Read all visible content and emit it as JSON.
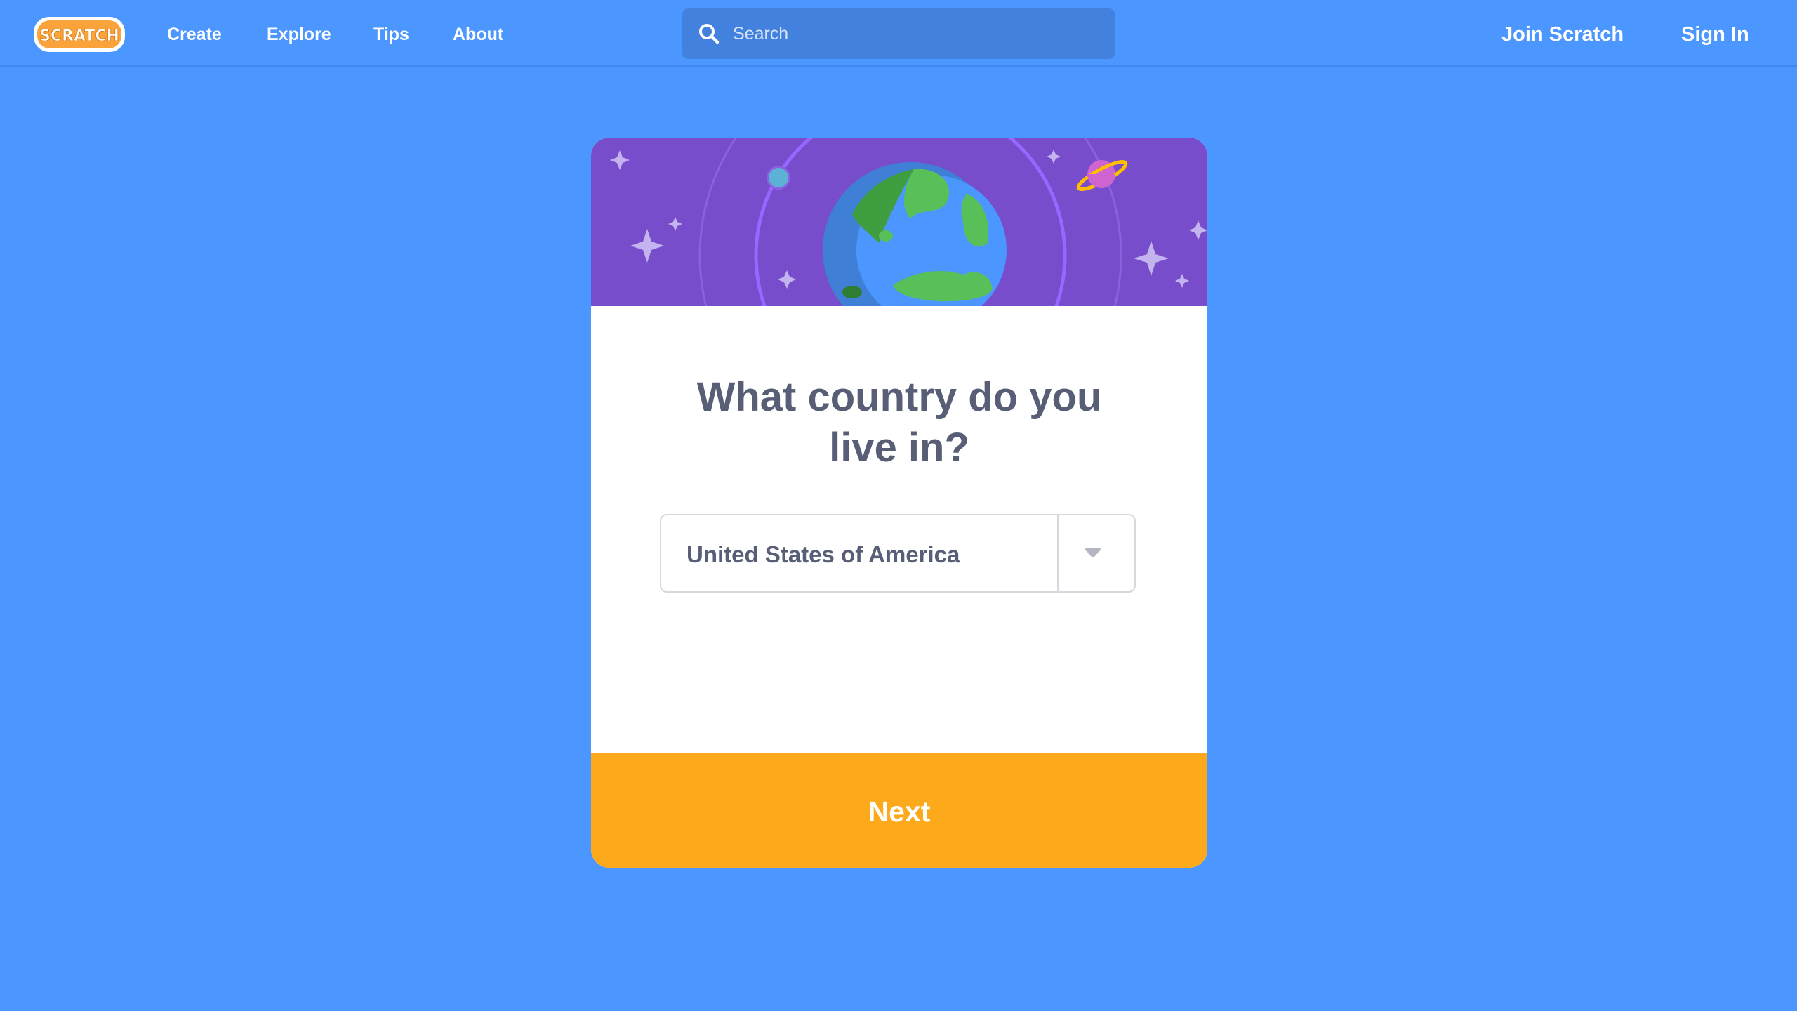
{
  "header": {
    "logo_text": "SCRATCH",
    "nav": {
      "create": "Create",
      "explore": "Explore",
      "tips": "Tips",
      "about": "About"
    },
    "search": {
      "placeholder": "Search",
      "icon": "search-icon"
    },
    "join_label": "Join Scratch",
    "signin_label": "Sign In"
  },
  "card": {
    "banner_icon": "globe-illustration",
    "title_line1": "What country do you",
    "title_line2": "live in?",
    "select": {
      "value": "United States of America",
      "icon": "chevron-down-icon"
    },
    "next_label": "Next"
  },
  "colors": {
    "background": "#4c97ff",
    "search_bg": "#4281de",
    "banner_purple": "#774dcb",
    "title_text": "#575e75",
    "next_button": "#fcaa1b",
    "logo_orange": "#f9a33a"
  }
}
